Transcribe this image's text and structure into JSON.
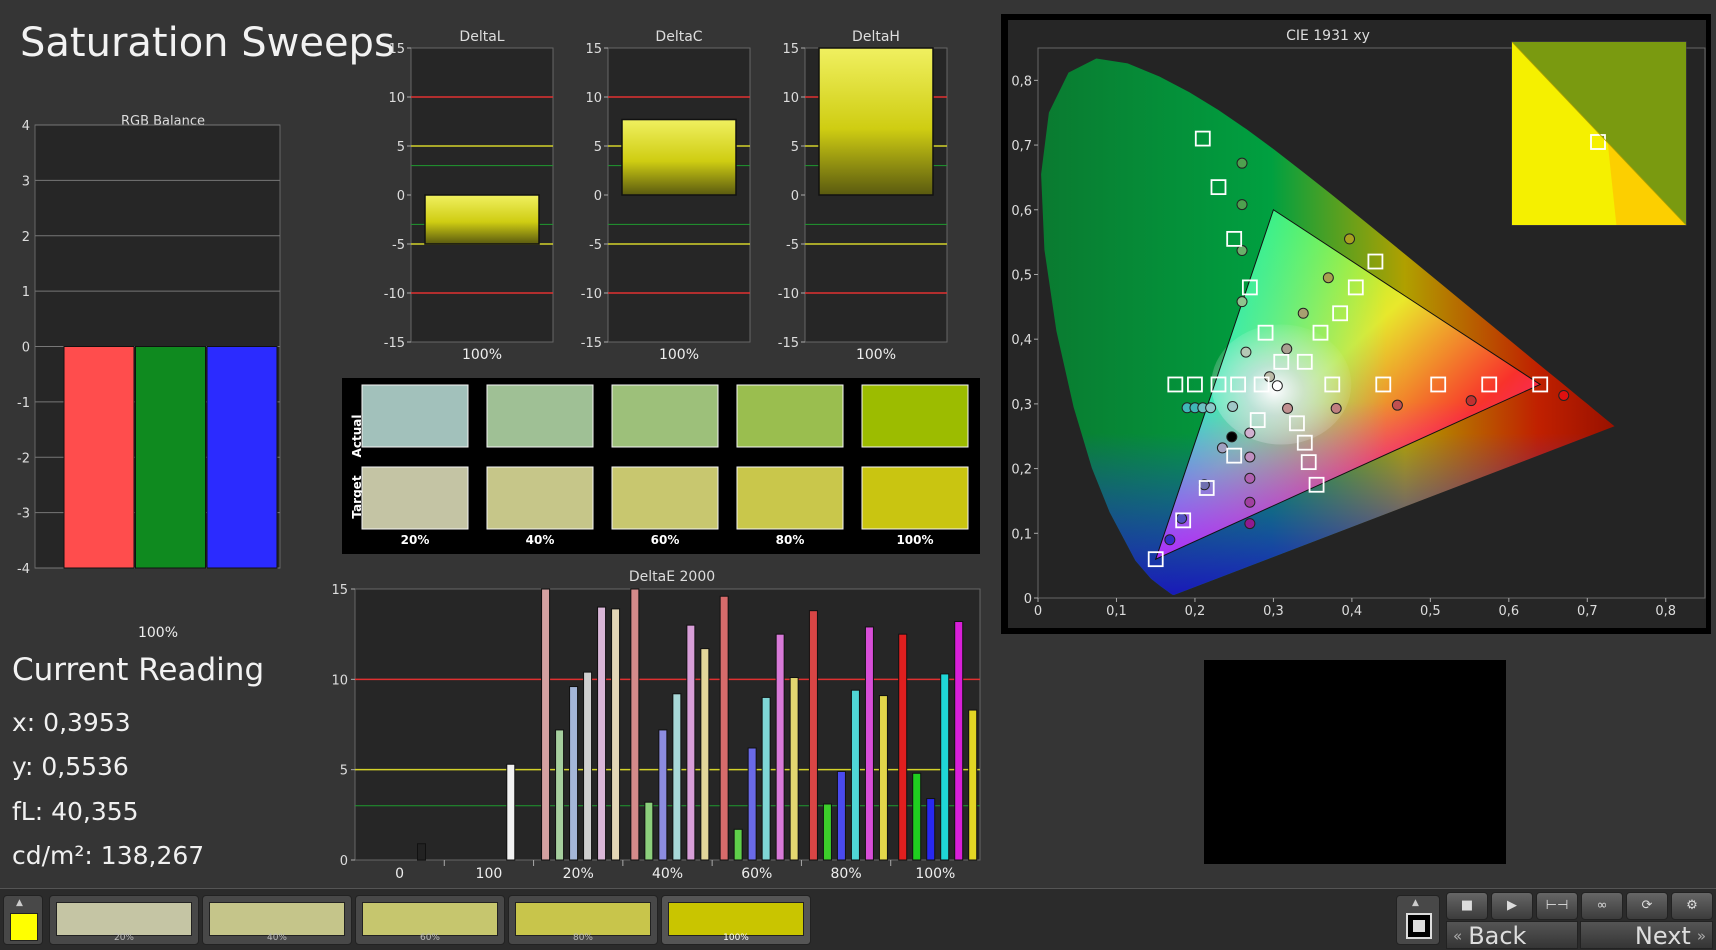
{
  "title": "Saturation Sweeps",
  "colors": {
    "background": "#353535",
    "panel": "#262626",
    "red_limit": "#e03030",
    "yellow_limit": "#d4d22a",
    "green_limit": "#1f9a2f",
    "target_color": "#c7c400"
  },
  "rgb_balance": {
    "title": "RGB Balance",
    "category": "100%",
    "yticks": [
      "4",
      "3",
      "2",
      "1",
      "0",
      "-1",
      "-2",
      "-3",
      "-4"
    ],
    "series": [
      {
        "name": "R",
        "value": -4,
        "color": "#ff4d4d"
      },
      {
        "name": "G",
        "value": -4,
        "color": "#0f8a1f"
      },
      {
        "name": "B",
        "value": -4,
        "color": "#2b2bff"
      }
    ]
  },
  "delta_charts": [
    {
      "title": "DeltaL",
      "category": "100%",
      "value": -5
    },
    {
      "title": "DeltaC",
      "category": "100%",
      "value": 7.7
    },
    {
      "title": "DeltaH",
      "category": "100%",
      "value": 15
    }
  ],
  "delta_yticks": [
    "15",
    "10",
    "5",
    "0",
    "-5",
    "-10",
    "-15"
  ],
  "swatches": {
    "actual_label": "Actual",
    "target_label": "Target",
    "columns": [
      {
        "label": "20%",
        "actual": "#a2c1bb",
        "target": "#c4c4a4"
      },
      {
        "label": "40%",
        "actual": "#9fc095",
        "target": "#c6c689"
      },
      {
        "label": "60%",
        "actual": "#9dc07a",
        "target": "#c8c76f"
      },
      {
        "label": "80%",
        "actual": "#9abe4f",
        "target": "#c9c74b"
      },
      {
        "label": "100%",
        "actual": "#9cbc00",
        "target": "#c9c511"
      }
    ]
  },
  "current_reading": {
    "title": "Current Reading",
    "x": "x: 0,3953",
    "y": "y: 0,5536",
    "fl": "fL: 40,355",
    "cdm2": "cd/m²: 138,267"
  },
  "chart_data": [
    {
      "type": "bar",
      "title": "DeltaE 2000",
      "categories": [
        "0",
        "100",
        "20%",
        "40%",
        "60%",
        "80%",
        "100%"
      ],
      "ylim": [
        0,
        15
      ],
      "yticks": [
        "15",
        "10",
        "5",
        "0"
      ],
      "series": [
        {
          "group": "0",
          "bars": [
            {
              "value": 0.9,
              "color": "#222222"
            }
          ]
        },
        {
          "group": "100",
          "bars": [
            {
              "value": 5.3,
              "color": "#f2f2f2"
            }
          ]
        },
        {
          "group": "20%",
          "bars": [
            {
              "value": 15,
              "color": "#d4a1a1"
            },
            {
              "value": 7.2,
              "color": "#a6cf9e"
            },
            {
              "value": 9.6,
              "color": "#a4b6d8"
            },
            {
              "value": 10.4,
              "color": "#cfcfcf"
            },
            {
              "value": 14,
              "color": "#dab7d8"
            },
            {
              "value": 13.9,
              "color": "#e3d6b6"
            }
          ]
        },
        {
          "group": "40%",
          "bars": [
            {
              "value": 15,
              "color": "#d48a8a"
            },
            {
              "value": 3.2,
              "color": "#8ccf7c"
            },
            {
              "value": 7.2,
              "color": "#8c8ce0"
            },
            {
              "value": 9.2,
              "color": "#a8d8d8"
            },
            {
              "value": 13,
              "color": "#d89ed8"
            },
            {
              "value": 11.7,
              "color": "#e2d69a"
            }
          ]
        },
        {
          "group": "60%",
          "bars": [
            {
              "value": 14.6,
              "color": "#d66b6b"
            },
            {
              "value": 1.7,
              "color": "#5fcf4a"
            },
            {
              "value": 6.2,
              "color": "#6a6ae8"
            },
            {
              "value": 9,
              "color": "#7fd6d6"
            },
            {
              "value": 12.5,
              "color": "#d87ad8"
            },
            {
              "value": 10.1,
              "color": "#e2d670"
            }
          ]
        },
        {
          "group": "80%",
          "bars": [
            {
              "value": 13.8,
              "color": "#d94545"
            },
            {
              "value": 3.1,
              "color": "#3ccf2a"
            },
            {
              "value": 4.9,
              "color": "#4a4aee"
            },
            {
              "value": 9.4,
              "color": "#4fd6d6"
            },
            {
              "value": 12.9,
              "color": "#d84ed8"
            },
            {
              "value": 9.1,
              "color": "#e2d64a"
            }
          ]
        },
        {
          "group": "100%",
          "bars": [
            {
              "value": 12.5,
              "color": "#e01f1f"
            },
            {
              "value": 4.8,
              "color": "#1fcf1f"
            },
            {
              "value": 3.4,
              "color": "#2828f0"
            },
            {
              "value": 10.3,
              "color": "#1fd6d6"
            },
            {
              "value": 13.2,
              "color": "#d81fd8"
            },
            {
              "value": 8.3,
              "color": "#e2d624"
            }
          ]
        }
      ]
    },
    {
      "type": "scatter",
      "title": "CIE 1931 xy",
      "xlim": [
        0,
        0.85
      ],
      "ylim": [
        0,
        0.85
      ],
      "xticks": [
        "0",
        "0,1",
        "0,2",
        "0,3",
        "0,4",
        "0,5",
        "0,6",
        "0,7",
        "0,8"
      ],
      "yticks": [
        "0",
        "0,1",
        "0,2",
        "0,3",
        "0,4",
        "0,5",
        "0,6",
        "0,7",
        "0,8"
      ],
      "gamut": [
        [
          0.64,
          0.33
        ],
        [
          0.3,
          0.6
        ],
        [
          0.15,
          0.06
        ]
      ],
      "targets": [
        [
          0.21,
          0.71
        ],
        [
          0.23,
          0.635
        ],
        [
          0.25,
          0.555
        ],
        [
          0.27,
          0.48
        ],
        [
          0.29,
          0.41
        ],
        [
          0.31,
          0.365
        ],
        [
          0.43,
          0.52
        ],
        [
          0.405,
          0.48
        ],
        [
          0.385,
          0.44
        ],
        [
          0.36,
          0.41
        ],
        [
          0.34,
          0.365
        ],
        [
          0.175,
          0.33
        ],
        [
          0.2,
          0.33
        ],
        [
          0.23,
          0.33
        ],
        [
          0.255,
          0.33
        ],
        [
          0.285,
          0.33
        ],
        [
          0.375,
          0.33
        ],
        [
          0.44,
          0.33
        ],
        [
          0.51,
          0.33
        ],
        [
          0.575,
          0.33
        ],
        [
          0.64,
          0.33
        ],
        [
          0.28,
          0.275
        ],
        [
          0.33,
          0.27
        ],
        [
          0.34,
          0.24
        ],
        [
          0.345,
          0.21
        ],
        [
          0.355,
          0.175
        ],
        [
          0.25,
          0.22
        ],
        [
          0.215,
          0.17
        ],
        [
          0.185,
          0.12
        ],
        [
          0.15,
          0.06
        ]
      ],
      "measured": [
        {
          "x": 0.26,
          "y": 0.672,
          "c": "#4fa04f"
        },
        {
          "x": 0.26,
          "y": 0.608,
          "c": "#4fa04f"
        },
        {
          "x": 0.26,
          "y": 0.537,
          "c": "#6ab06a"
        },
        {
          "x": 0.26,
          "y": 0.458,
          "c": "#8ec48e"
        },
        {
          "x": 0.265,
          "y": 0.38,
          "c": "#b5c9b5"
        },
        {
          "x": 0.397,
          "y": 0.555,
          "c": "#a8a020"
        },
        {
          "x": 0.37,
          "y": 0.495,
          "c": "#a8a050"
        },
        {
          "x": 0.338,
          "y": 0.44,
          "c": "#a8a070"
        },
        {
          "x": 0.317,
          "y": 0.385,
          "c": "#a8a090"
        },
        {
          "x": 0.295,
          "y": 0.342,
          "c": "#bcbca8"
        },
        {
          "x": 0.19,
          "y": 0.294,
          "c": "#3fb8b8"
        },
        {
          "x": 0.2,
          "y": 0.294,
          "c": "#3fb8b8"
        },
        {
          "x": 0.21,
          "y": 0.294,
          "c": "#6ac0c0"
        },
        {
          "x": 0.22,
          "y": 0.294,
          "c": "#8cc8c8"
        },
        {
          "x": 0.248,
          "y": 0.296,
          "c": "#a0c8c8"
        },
        {
          "x": 0.318,
          "y": 0.293,
          "c": "#c09090"
        },
        {
          "x": 0.38,
          "y": 0.293,
          "c": "#c08080"
        },
        {
          "x": 0.458,
          "y": 0.298,
          "c": "#c05050"
        },
        {
          "x": 0.552,
          "y": 0.305,
          "c": "#c03030"
        },
        {
          "x": 0.67,
          "y": 0.313,
          "c": "#e01010"
        },
        {
          "x": 0.27,
          "y": 0.255,
          "c": "#d0b0d0"
        },
        {
          "x": 0.27,
          "y": 0.218,
          "c": "#c090c0"
        },
        {
          "x": 0.27,
          "y": 0.185,
          "c": "#b060b0"
        },
        {
          "x": 0.27,
          "y": 0.148,
          "c": "#a040a0"
        },
        {
          "x": 0.27,
          "y": 0.115,
          "c": "#901a90"
        },
        {
          "x": 0.235,
          "y": 0.232,
          "c": "#a0a0c0"
        },
        {
          "x": 0.212,
          "y": 0.175,
          "c": "#7070b0"
        },
        {
          "x": 0.183,
          "y": 0.123,
          "c": "#5050c0"
        },
        {
          "x": 0.168,
          "y": 0.09,
          "c": "#3030c8"
        },
        {
          "x": 0.247,
          "y": 0.249,
          "c": "#000000"
        },
        {
          "x": 0.305,
          "y": 0.328,
          "c": "#ffffff"
        }
      ],
      "inset_current": {
        "x": 0.3953,
        "y": 0.5536
      }
    }
  ],
  "toolbar": {
    "current_swatch": "#ffff00",
    "buttons": [
      {
        "label": "20%",
        "color": "#c5c5a4"
      },
      {
        "label": "40%",
        "color": "#c5c58a"
      },
      {
        "label": "60%",
        "color": "#c6c66e"
      },
      {
        "label": "80%",
        "color": "#c8c54b"
      },
      {
        "label": "100%",
        "color": "#c9c500"
      }
    ],
    "back_label": "Back",
    "next_label": "Next"
  }
}
